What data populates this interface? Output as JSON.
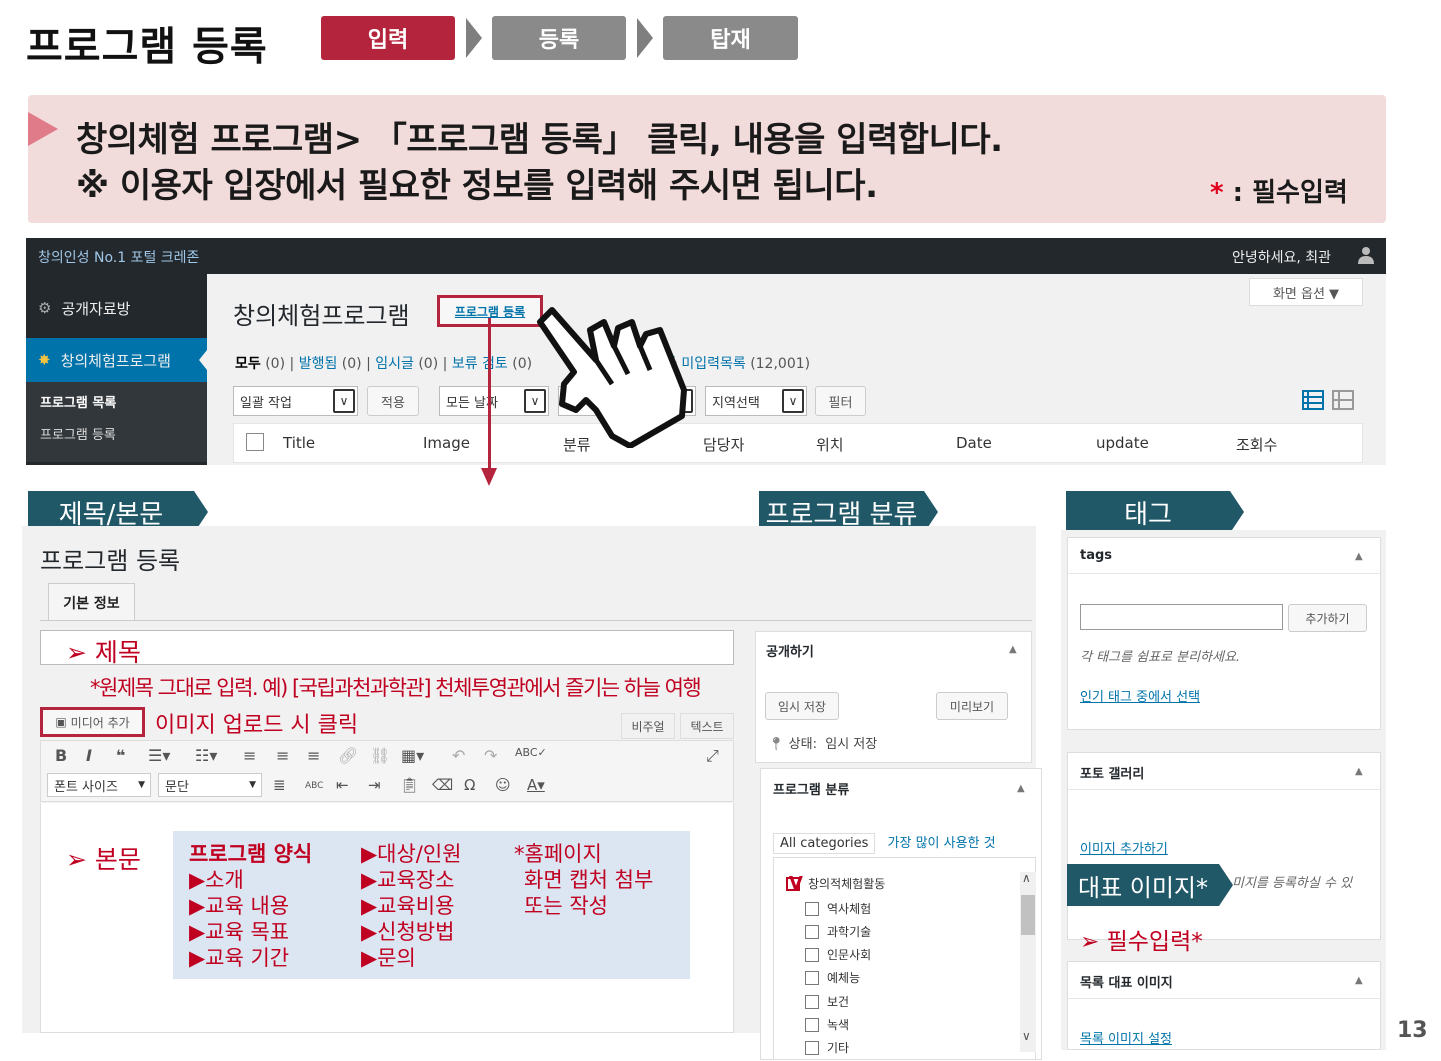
{
  "header": {
    "title": "프로그램 등록",
    "steps": [
      "입력",
      "등록",
      "탑재"
    ]
  },
  "banner": {
    "line1": "창의체험 프로그램> 「프로그램 등록」 클릭, 내용을 입력합니다.",
    "line2": "※ 이용자 입장에서 필요한 정보를 입력해 주시면 됩니다.",
    "required_star": "*",
    "required_label": " : 필수입력"
  },
  "wp": {
    "site_name": "창의인성 No.1 포털 크레존",
    "greeting": "안녕하세요, 최관",
    "sidebar": {
      "items": [
        "공개자료방",
        "창의체험프로그램"
      ],
      "submenu": [
        "프로그램 목록",
        "프로그램 등록"
      ]
    },
    "page_title": "창의체험프로그램",
    "add_new": "프로그램 등록",
    "screen_options": "화면 옵션 ▼",
    "filters": {
      "all": "모두",
      "all_count": "(0)",
      "published": "발행됨",
      "published_count": "(0)",
      "draft": "임시글",
      "draft_count": "(0)",
      "pending": "보류 검토",
      "pending_count": "(0)",
      "other": "타 미입력목록",
      "other_count": "(12,001)"
    },
    "bulk_action": "일괄 작업",
    "apply": "적용",
    "all_dates": "모든 날짜",
    "region": "지역선택",
    "filter": "필터",
    "columns": [
      "Title",
      "Image",
      "분류",
      "담당자",
      "위치",
      "Date",
      "update",
      "조회수"
    ]
  },
  "sections": {
    "title_body": "제목/본문",
    "category": "프로그램 분류",
    "tags": "태그",
    "featured": "대표 이미지*"
  },
  "editor": {
    "page_title": "프로그램 등록",
    "tab": "기본 정보",
    "title_label": "➢ 제목",
    "title_note": "*원제목 그대로 입력. 예) [국립과천과학관] 천체투영관에서 즐기는 하늘 여행",
    "media_button": "미디어 추가",
    "media_note": "이미지 업로드 시 클릭",
    "visual_tab": "비주얼",
    "text_tab": "텍스트",
    "font_size": "폰트 사이즈",
    "paragraph": "문단",
    "body_label": "➢ 본문",
    "form_title": "프로그램 양식",
    "form_col1": [
      "▶소개",
      "▶교육 내용",
      "▶교육 목표",
      "▶교육 기간"
    ],
    "form_col2": [
      "▶대상/인원",
      "▶교육장소",
      "▶교육비용",
      "▶신청방법",
      "▶문의"
    ],
    "form_col3": [
      "*홈페이지",
      "화면 캡처 첨부",
      "또는 작성"
    ]
  },
  "publish": {
    "heading": "공개하기",
    "save_draft": "임시 저장",
    "preview": "미리보기",
    "status_label": "상태:",
    "status_value": "임시 저장"
  },
  "categories": {
    "heading": "프로그램 분류",
    "tab_all": "All categories",
    "tab_popular": "가장 많이 사용한 것",
    "parent": "창의적체험활동",
    "items": [
      "역사체험",
      "과학기술",
      "인문사회",
      "예체능",
      "보건",
      "녹색",
      "기타"
    ]
  },
  "tags_box": {
    "heading": "tags",
    "add_button": "추가하기",
    "hint": "각 태그를 쉼표로 분리하세요.",
    "popular_link": "인기 태그 중에서 선택"
  },
  "gallery": {
    "heading": "포토 갤러리",
    "add_link": "이미지 추가하기",
    "hint_partial": "미지를 등록하실 수 있",
    "required_note": "➢ 필수입력*"
  },
  "list_image": {
    "heading": "목록 대표 이미지",
    "set_link": "목록 이미지 설정"
  },
  "page_number": "13",
  "colors": {
    "accent_red": "#b5243d",
    "section_teal": "#215868",
    "wp_dark": "#23282d",
    "wp_blue": "#0073aa",
    "banner_bg": "#f2dcdb",
    "form_bg": "#dce6f2"
  }
}
